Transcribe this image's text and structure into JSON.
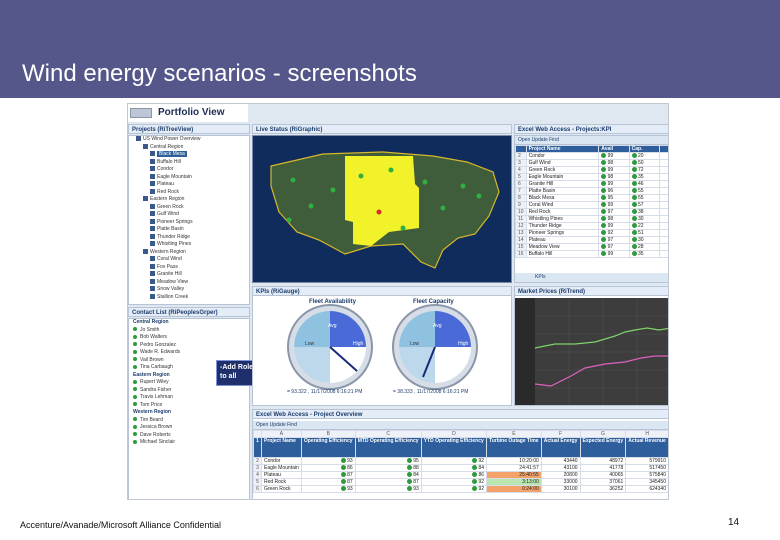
{
  "slide": {
    "title": "Wind energy scenarios - screenshots",
    "footer": "Accenture/Avanade/Microsoft Alliance Confidential",
    "page_number": "14"
  },
  "portfolio": {
    "title": "Portfolio View",
    "projects_header": "Projects (RiTreeView)",
    "tree": [
      {
        "label": "US Wind Power Overview",
        "level": 1
      },
      {
        "label": "Central Region",
        "level": 2
      },
      {
        "label": "Black Mesa",
        "level": 3,
        "selected": true
      },
      {
        "label": "Buffalo Hill",
        "level": 3
      },
      {
        "label": "Condor",
        "level": 3
      },
      {
        "label": "Eagle Mountain",
        "level": 3
      },
      {
        "label": "Plateau",
        "level": 3
      },
      {
        "label": "Red Rock",
        "level": 3
      },
      {
        "label": "Eastern Region",
        "level": 2
      },
      {
        "label": "Green Rock",
        "level": 3
      },
      {
        "label": "Gulf Wind",
        "level": 3
      },
      {
        "label": "Pioneer Springs",
        "level": 3
      },
      {
        "label": "Platte Basin",
        "level": 3
      },
      {
        "label": "Thunder Ridge",
        "level": 3
      },
      {
        "label": "Whistling Pines",
        "level": 3
      },
      {
        "label": "Western Region",
        "level": 2
      },
      {
        "label": "Coral Wind",
        "level": 3
      },
      {
        "label": "Fox Pass",
        "level": 3
      },
      {
        "label": "Granite Hill",
        "level": 3
      },
      {
        "label": "Meadow View",
        "level": 3
      },
      {
        "label": "Snow Valley",
        "level": 3
      },
      {
        "label": "Stallion Creek",
        "level": 3
      }
    ],
    "contacts_header": "Contact List (RiPeoplesGrper)",
    "contacts": [
      {
        "label": "Central Region",
        "type": "header"
      },
      {
        "label": "Jo Smith",
        "type": "person"
      },
      {
        "label": "Bob Walters",
        "type": "person"
      },
      {
        "label": "Pedro Gonzalez",
        "type": "person"
      },
      {
        "label": "Wade R. Edwards",
        "type": "person"
      },
      {
        "label": "Vail Brown",
        "type": "person"
      },
      {
        "label": "Tina Carbaugh",
        "type": "person"
      },
      {
        "label": "Eastern Region",
        "type": "header"
      },
      {
        "label": "Rupert Wiley",
        "type": "person"
      },
      {
        "label": "Sandra Fisher",
        "type": "person"
      },
      {
        "label": "Travis Lehman",
        "type": "person"
      },
      {
        "label": "Tom Price",
        "type": "person"
      },
      {
        "label": "Western Region",
        "type": "header"
      },
      {
        "label": "Tim Beard",
        "type": "person"
      },
      {
        "label": "Jessica Brown",
        "type": "person"
      },
      {
        "label": "Dave Roberts",
        "type": "person"
      },
      {
        "label": "Michael Sinclair",
        "type": "person"
      }
    ],
    "callout": "-Add Role/Title to all"
  },
  "live_status": {
    "header": "Live Status (RiGraphic)"
  },
  "excel_top": {
    "header": "Excel Web Access - Projects:KPI",
    "toolbar": "Open  Update  Find",
    "columns": [
      "Project Name",
      "Avail",
      "Cap."
    ],
    "rows": [
      {
        "name": "Condor",
        "avail": "99",
        "cap": "20",
        "status": "g"
      },
      {
        "name": "Gulf Wind",
        "avail": "98",
        "cap": "50",
        "status": "g"
      },
      {
        "name": "Green Rock",
        "avail": "99",
        "cap": "72",
        "status": "g"
      },
      {
        "name": "Eagle Mountain",
        "avail": "98",
        "cap": "35",
        "status": "g"
      },
      {
        "name": "Granite Hill",
        "avail": "99",
        "cap": "46",
        "status": "g"
      },
      {
        "name": "Platte Basin",
        "avail": "96",
        "cap": "55",
        "status": "g"
      },
      {
        "name": "Black Mesa",
        "avail": "95",
        "cap": "55",
        "status": "g"
      },
      {
        "name": "Coral Wind",
        "avail": "99",
        "cap": "57",
        "status": "g"
      },
      {
        "name": "Red Rock",
        "avail": "97",
        "cap": "38",
        "status": "g"
      },
      {
        "name": "Whistling Pines",
        "avail": "98",
        "cap": "30",
        "status": "g"
      },
      {
        "name": "Thunder Ridge",
        "avail": "99",
        "cap": "22",
        "status": "g"
      },
      {
        "name": "Pioneer Springs",
        "avail": "92",
        "cap": "51",
        "status": "g"
      },
      {
        "name": "Plateau",
        "avail": "97",
        "cap": "30",
        "status": "g"
      },
      {
        "name": "Meadow View",
        "avail": "97",
        "cap": "28",
        "status": "g"
      },
      {
        "name": "Buffalo Hill",
        "avail": "99",
        "cap": "35",
        "status": "g"
      }
    ],
    "tab": "KPIs"
  },
  "kpis": {
    "header": "KPIs (RiGauge)",
    "fleet_availability": "Fleet Availability",
    "fleet_capacity": "Fleet Capacity",
    "gauge_labels": [
      "Avg",
      "High",
      "Low"
    ],
    "avail_readout": "= 93.322 , 11/17/2008 6:16:21 PM",
    "capacity_readout": "= 38.333 , 11/17/2008 6:16:21 PM"
  },
  "market": {
    "header": "Market Prices (RiTrend)"
  },
  "excel_bottom": {
    "header": "Excel Web Access - Project Overview",
    "toolbar": "Open  Update  Find",
    "col_letters": [
      "A",
      "B",
      "C",
      "D",
      "E",
      "F",
      "G",
      "H"
    ],
    "headers": [
      "Project Name",
      "Operating Efficiency",
      "MTD Operating Efficiency",
      "YTD Operating Efficiency",
      "Turbine Outage Time",
      "Actual Energy",
      "Expected Energy",
      "Actual Revenue"
    ],
    "rows": [
      {
        "name": "Condor",
        "op": "93",
        "mtd": "95",
        "ytd": "92",
        "outage": "10:20:00",
        "actual": "43440",
        "expected": "48972",
        "revenue": "579910",
        "flag": ""
      },
      {
        "name": "Eagle Mountain",
        "op": "86",
        "mtd": "88",
        "ytd": "84",
        "outage": "24:41:57",
        "actual": "43100",
        "expected": "41778",
        "revenue": "517450",
        "flag": ""
      },
      {
        "name": "Plateau",
        "op": "87",
        "mtd": "84",
        "ytd": "86",
        "outage": "25:40:55",
        "actual": "20800",
        "expected": "40065",
        "revenue": "575840",
        "flag": "hi"
      },
      {
        "name": "Red Rock",
        "op": "87",
        "mtd": "87",
        "ytd": "92",
        "outage": "3:13:00",
        "actual": "33000",
        "expected": "37061",
        "revenue": "345450",
        "flag": "ok"
      },
      {
        "name": "Green Rock",
        "op": "93",
        "mtd": "93",
        "ytd": "92",
        "outage": "0:24:00",
        "actual": "30100",
        "expected": "36252",
        "revenue": "624340",
        "flag": "hi"
      }
    ]
  },
  "colors": {
    "banner": "#55578a",
    "panel_header": "#2f5e9c",
    "map_yellow": "#f2f22a"
  }
}
